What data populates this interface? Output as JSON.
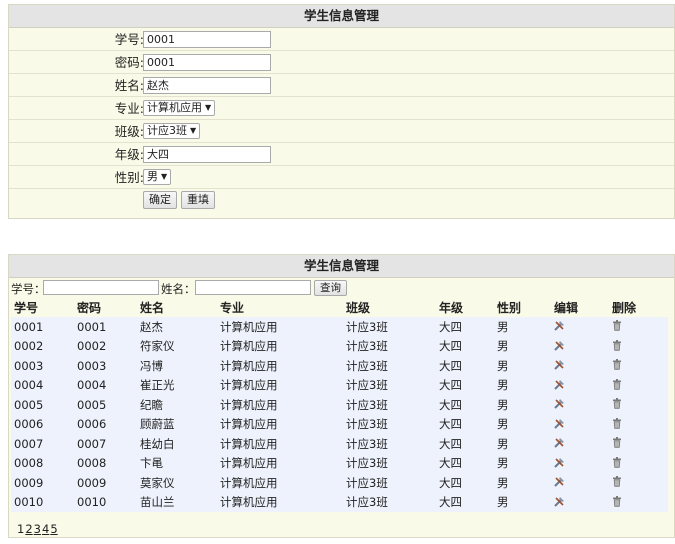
{
  "form": {
    "title": "学生信息管理",
    "fields": [
      {
        "label": "学号:",
        "type": "text",
        "value": "0001"
      },
      {
        "label": "密码:",
        "type": "text",
        "value": "0001"
      },
      {
        "label": "姓名:",
        "type": "text",
        "value": "赵杰"
      },
      {
        "label": "专业:",
        "type": "select",
        "value": "计算机应用"
      },
      {
        "label": "班级:",
        "type": "select",
        "value": "计应3班"
      },
      {
        "label": "年级:",
        "type": "text",
        "value": "大四"
      },
      {
        "label": "性别:",
        "type": "select",
        "value": "男"
      }
    ],
    "confirm_label": "确定",
    "reset_label": "重填"
  },
  "list": {
    "title": "学生信息管理",
    "search": {
      "id_label": "学号：",
      "name_label": "姓名：",
      "button_label": "查询"
    },
    "columns": [
      "学号",
      "密码",
      "姓名",
      "专业",
      "班级",
      "年级",
      "性别",
      "编辑",
      "删除"
    ],
    "rows": [
      [
        "0001",
        "0001",
        "赵杰",
        "计算机应用",
        "计应3班",
        "大四",
        "男"
      ],
      [
        "0002",
        "0002",
        "符家仪",
        "计算机应用",
        "计应3班",
        "大四",
        "男"
      ],
      [
        "0003",
        "0003",
        "冯博",
        "计算机应用",
        "计应3班",
        "大四",
        "男"
      ],
      [
        "0004",
        "0004",
        "崔正光",
        "计算机应用",
        "计应3班",
        "大四",
        "男"
      ],
      [
        "0005",
        "0005",
        "纪瞻",
        "计算机应用",
        "计应3班",
        "大四",
        "男"
      ],
      [
        "0006",
        "0006",
        "顾蔚蓝",
        "计算机应用",
        "计应3班",
        "大四",
        "男"
      ],
      [
        "0007",
        "0007",
        "桂幼白",
        "计算机应用",
        "计应3班",
        "大四",
        "男"
      ],
      [
        "0008",
        "0008",
        "卞黾",
        "计算机应用",
        "计应3班",
        "大四",
        "男"
      ],
      [
        "0009",
        "0009",
        "莫家仪",
        "计算机应用",
        "计应3班",
        "大四",
        "男"
      ],
      [
        "0010",
        "0010",
        "苗山兰",
        "计算机应用",
        "计应3班",
        "大四",
        "男"
      ]
    ],
    "edit_icon": "edit-tools-icon",
    "delete_icon": "trash-icon",
    "pagination": [
      "1",
      "2",
      "3",
      "4",
      "5"
    ],
    "current_page": "1"
  }
}
